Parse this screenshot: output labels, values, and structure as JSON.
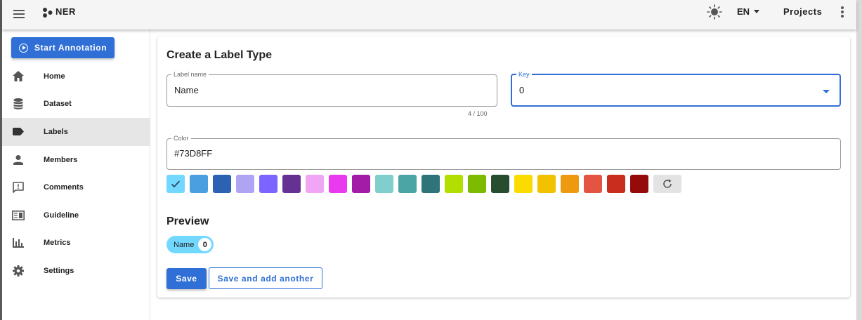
{
  "appbar": {
    "title": "NER",
    "language": "EN",
    "projects_label": "Projects",
    "icons": [
      "menu-icon",
      "project-logo-icon",
      "theme-toggle-icon",
      "chevron-down-icon",
      "more-vert-icon"
    ]
  },
  "sidebar": {
    "start_button": "Start Annotation",
    "items": [
      {
        "label": "Home",
        "icon": "home-icon"
      },
      {
        "label": "Dataset",
        "icon": "database-icon"
      },
      {
        "label": "Labels",
        "icon": "label-icon",
        "active": true
      },
      {
        "label": "Members",
        "icon": "person-icon"
      },
      {
        "label": "Comments",
        "icon": "comment-icon"
      },
      {
        "label": "Guideline",
        "icon": "book-icon"
      },
      {
        "label": "Metrics",
        "icon": "chart-icon"
      },
      {
        "label": "Settings",
        "icon": "gear-icon"
      }
    ]
  },
  "form": {
    "title": "Create a Label Type",
    "label_name": {
      "legend": "Label name",
      "value": "Name",
      "counter": "4 / 100"
    },
    "key": {
      "legend": "Key",
      "value": "0"
    },
    "color": {
      "legend": "Color",
      "value": "#73D8FF"
    },
    "swatches": [
      {
        "color": "#73D8FF",
        "selected": true
      },
      {
        "color": "#4A9FE0"
      },
      {
        "color": "#2C62B3"
      },
      {
        "color": "#AFA4F3"
      },
      {
        "color": "#7B64FF"
      },
      {
        "color": "#653294"
      },
      {
        "color": "#F0A5F5"
      },
      {
        "color": "#E93AF0"
      },
      {
        "color": "#A31CA8"
      },
      {
        "color": "#80CFCC"
      },
      {
        "color": "#4BA5A5"
      },
      {
        "color": "#2E7478"
      },
      {
        "color": "#B2DF00"
      },
      {
        "color": "#7CBB00"
      },
      {
        "color": "#264D30"
      },
      {
        "color": "#FCDC00"
      },
      {
        "color": "#F2C200"
      },
      {
        "color": "#EE9A10"
      },
      {
        "color": "#E35442"
      },
      {
        "color": "#C92D1E"
      },
      {
        "color": "#950A0A"
      }
    ],
    "preview": {
      "title": "Preview",
      "chip_label": "Name",
      "chip_key": "0"
    },
    "save_label": "Save",
    "save_add_label": "Save and add another"
  }
}
